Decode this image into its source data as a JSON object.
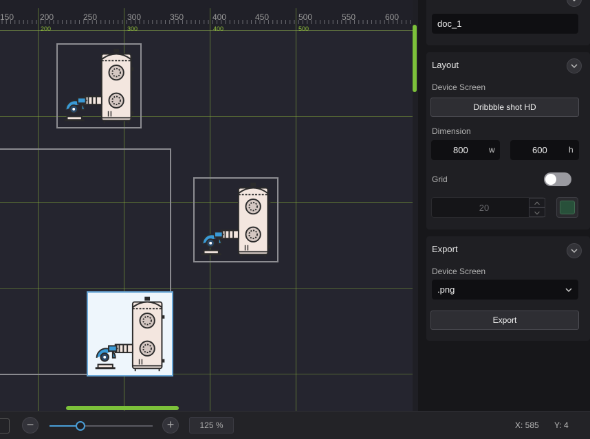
{
  "ruler": {
    "labels": [
      "150",
      "200",
      "250",
      "300",
      "350",
      "400",
      "450",
      "500",
      "550",
      "600"
    ],
    "sub_labels": [
      "200",
      "300",
      "400",
      "500"
    ]
  },
  "canvas": {
    "accent_color": "#7cc13a",
    "grid_color": "#8cb43c",
    "assets": [
      {
        "name": "scrubber-tower-asset-1",
        "selected": false
      },
      {
        "name": "scrubber-tower-asset-2",
        "selected": false
      },
      {
        "name": "scrubber-tower-asset-3",
        "selected": true
      }
    ]
  },
  "bottom_bar": {
    "zoom_label": "125 %",
    "zoom_minus": "−",
    "zoom_plus": "+",
    "zoom_slider_fraction": 0.3,
    "coord_x": "X: 585",
    "coord_y": "Y: 4"
  },
  "panel": {
    "doc_name": "doc_1",
    "layout": {
      "title": "Layout",
      "device_screen_label": "Device Screen",
      "device_screen_value": "Dribbble shot HD",
      "dimension_label": "Dimension",
      "width_value": "800",
      "width_unit": "w",
      "height_value": "600",
      "height_unit": "h",
      "grid_label": "Grid",
      "grid_enabled": false,
      "grid_size": "20",
      "grid_color": "#28503a"
    },
    "export": {
      "title": "Export",
      "device_screen_label": "Device Screen",
      "format_value": ".png",
      "export_button": "Export"
    }
  }
}
